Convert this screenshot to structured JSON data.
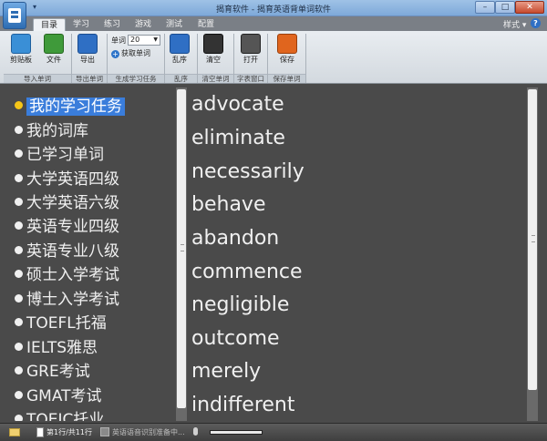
{
  "window": {
    "title": "揭育软件 - 揭育英语背单词软件",
    "minimize": "–",
    "maximize": "□",
    "close": "✕"
  },
  "quick_access": "▾",
  "tabs": [
    "目录",
    "学习",
    "练习",
    "游戏",
    "测试",
    "配置"
  ],
  "active_tab": "目录",
  "style_menu": "样式 ▾",
  "help": "?",
  "ribbon": {
    "clipboard": "剪贴板",
    "file": "文件",
    "export": "导出",
    "word_count_label": "单词",
    "word_count_value": "20",
    "generate_words": "获取单词",
    "shuffle": "乱序",
    "clear": "清空",
    "open": "打开",
    "save": "保存",
    "groups": {
      "import": "导入单词",
      "export": "导出单词",
      "generate": "生成学习任务",
      "shuffle": "乱序",
      "clear": "清空单词",
      "dictionary": "字表窗口",
      "save": "保存单词"
    },
    "icon_colors": {
      "clipboard": "#3a8fd6",
      "file": "#3f9a3a",
      "export": "#2f6fc4",
      "shuffle": "#2f6fc4",
      "clear": "#333333",
      "open": "#555555",
      "save": "#e0651e"
    }
  },
  "categories": [
    "我的学习任务",
    "我的词库",
    "已学习单词",
    "大学英语四级",
    "大学英语六级",
    "英语专业四级",
    "英语专业八级",
    "硕士入学考试",
    "博士入学考试",
    "TOEFL托福",
    "IELTS雅思",
    "GRE考试",
    "GMAT考试",
    "TOEIC托业"
  ],
  "selected_category_index": 0,
  "words": [
    "advocate",
    "eliminate",
    "necessarily",
    "behave",
    "abandon",
    "commence",
    "negligible",
    "outcome",
    "merely",
    "indifferent"
  ],
  "status": {
    "position": "第1行/共11行",
    "speech": "英语语音识别准备中..."
  },
  "progress_fraction": 1.0
}
